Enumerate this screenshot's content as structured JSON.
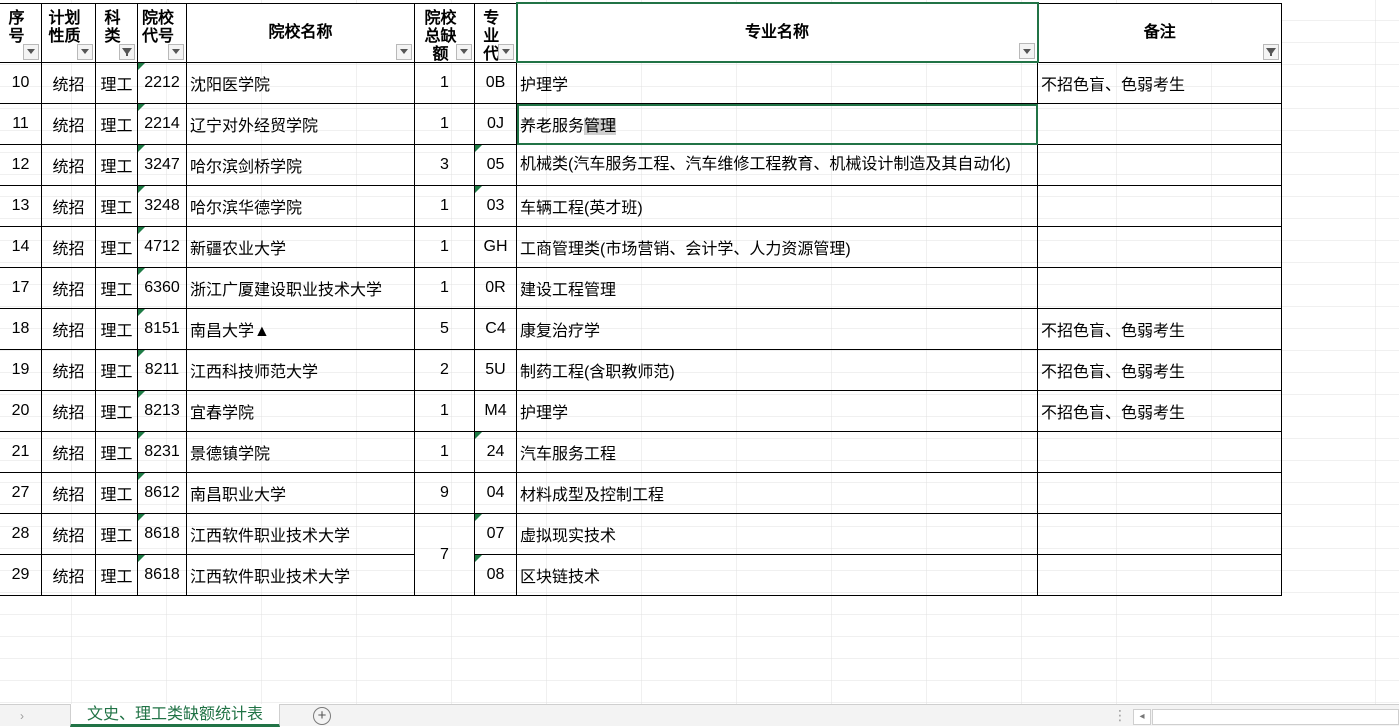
{
  "headers": [
    {
      "label": "序号",
      "filter": "dropdown"
    },
    {
      "label": "计划性质",
      "filter": "dropdown"
    },
    {
      "label": "科类",
      "filter": "funnel"
    },
    {
      "label": "院校代号",
      "filter": "dropdown"
    },
    {
      "label": "院校名称",
      "filter": "dropdown"
    },
    {
      "label": "院校总缺额",
      "filter": "dropdown"
    },
    {
      "label": "专业代号",
      "filter": "dropdown"
    },
    {
      "label": "专业名称",
      "filter": "dropdown"
    },
    {
      "label": "备注",
      "filter": "funnel"
    }
  ],
  "rows": [
    {
      "seq": "10",
      "plan": "统招",
      "category": "理工",
      "code": "2212",
      "school": "沈阳医学院",
      "total": "1",
      "major_code": "0B",
      "major": "护理学",
      "note": "不招色盲、色弱考生"
    },
    {
      "seq": "11",
      "plan": "统招",
      "category": "理工",
      "code": "2214",
      "school": "辽宁对外经贸学院",
      "total": "1",
      "major_code": "0J",
      "major_pre": "养老服务",
      "major_hl": "管理",
      "note": ""
    },
    {
      "seq": "12",
      "plan": "统招",
      "category": "理工",
      "code": "3247",
      "school": "哈尔滨剑桥学院",
      "total": "3",
      "major_code": "05",
      "major": "机械类(汽车服务工程、汽车维修工程教育、机械设计制造及其自动化)",
      "note": ""
    },
    {
      "seq": "13",
      "plan": "统招",
      "category": "理工",
      "code": "3248",
      "school": "哈尔滨华德学院",
      "total": "1",
      "major_code": "03",
      "major": "车辆工程(英才班)",
      "note": ""
    },
    {
      "seq": "14",
      "plan": "统招",
      "category": "理工",
      "code": "4712",
      "school": "新疆农业大学",
      "total": "1",
      "major_code": "GH",
      "major": "工商管理类(市场营销、会计学、人力资源管理)",
      "note": ""
    },
    {
      "seq": "17",
      "plan": "统招",
      "category": "理工",
      "code": "6360",
      "school": "浙江广厦建设职业技术大学",
      "total": "1",
      "major_code": "0R",
      "major": "建设工程管理",
      "note": ""
    },
    {
      "seq": "18",
      "plan": "统招",
      "category": "理工",
      "code": "8151",
      "school": "南昌大学▲",
      "total": "5",
      "major_code": "C4",
      "major": "康复治疗学",
      "note": "不招色盲、色弱考生"
    },
    {
      "seq": "19",
      "plan": "统招",
      "category": "理工",
      "code": "8211",
      "school": "江西科技师范大学",
      "total": "2",
      "major_code": "5U",
      "major": "制药工程(含职教师范)",
      "note": "不招色盲、色弱考生"
    },
    {
      "seq": "20",
      "plan": "统招",
      "category": "理工",
      "code": "8213",
      "school": "宜春学院",
      "total": "1",
      "major_code": "M4",
      "major": "护理学",
      "note": "不招色盲、色弱考生"
    },
    {
      "seq": "21",
      "plan": "统招",
      "category": "理工",
      "code": "8231",
      "school": "景德镇学院",
      "total": "1",
      "major_code": "24",
      "major": "汽车服务工程",
      "note": ""
    },
    {
      "seq": "27",
      "plan": "统招",
      "category": "理工",
      "code": "8612",
      "school": "南昌职业大学",
      "total": "9",
      "major_code": "04",
      "major": "材料成型及控制工程",
      "note": ""
    },
    {
      "seq": "28",
      "plan": "统招",
      "category": "理工",
      "code": "8618",
      "school": "江西软件职业技术大学",
      "total": "7",
      "major_code": "07",
      "major": "虚拟现实技术",
      "note": ""
    },
    {
      "seq": "29",
      "plan": "统招",
      "category": "理工",
      "code": "8618",
      "school": "江西软件职业技术大学",
      "total": "",
      "major_code": "08",
      "major": "区块链技术",
      "note": ""
    }
  ],
  "sheet_tab": "文史、理工类缺额统计表",
  "add_sheet_icon": "plus-circle-icon",
  "accent_color": "#217346",
  "triangle_color": "#1e7b45"
}
